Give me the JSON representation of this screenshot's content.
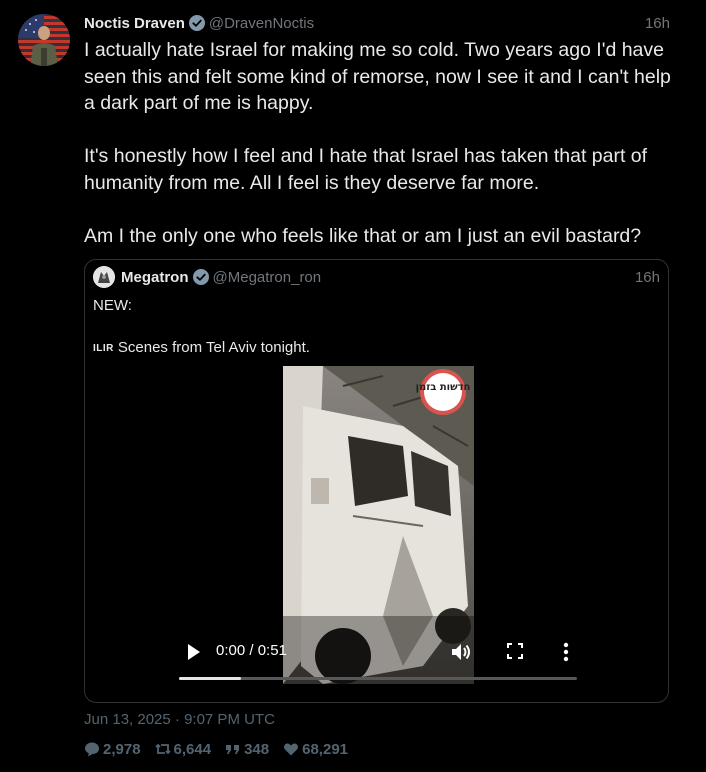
{
  "author": {
    "name": "Noctis Draven",
    "handle": "@DravenNoctis",
    "time": "16h"
  },
  "text": "I actually hate Israel for making me so cold. Two years ago I'd have seen this and felt some kind of remorse, now I see it and I can't help a dark part of me is happy.\n\nIt's honestly how I feel and I hate that Israel has taken that part of humanity from me. All I feel is they deserve far more.\n\nAm I the only one who feels like that or am I just an evil bastard?",
  "quote": {
    "name": "Megatron",
    "handle": "@Megatron_ron",
    "time": "16h",
    "line1": "NEW:",
    "flag": "ILIR",
    "line2": "Scenes from Tel Aviv tonight.",
    "video": {
      "watermark": "חדשות בזמן",
      "time_label": "0:00 / 0:51",
      "progress": 0.155
    }
  },
  "footer": {
    "date": "Jun 13, 2025 · 9:07 PM UTC",
    "replies": "2,978",
    "retweets": "6,644",
    "quotes": "348",
    "likes": "68,291"
  },
  "colors": {
    "background": "#000000",
    "text": "#e7e9ea",
    "muted": "#71767b",
    "verified": "#829aab"
  }
}
